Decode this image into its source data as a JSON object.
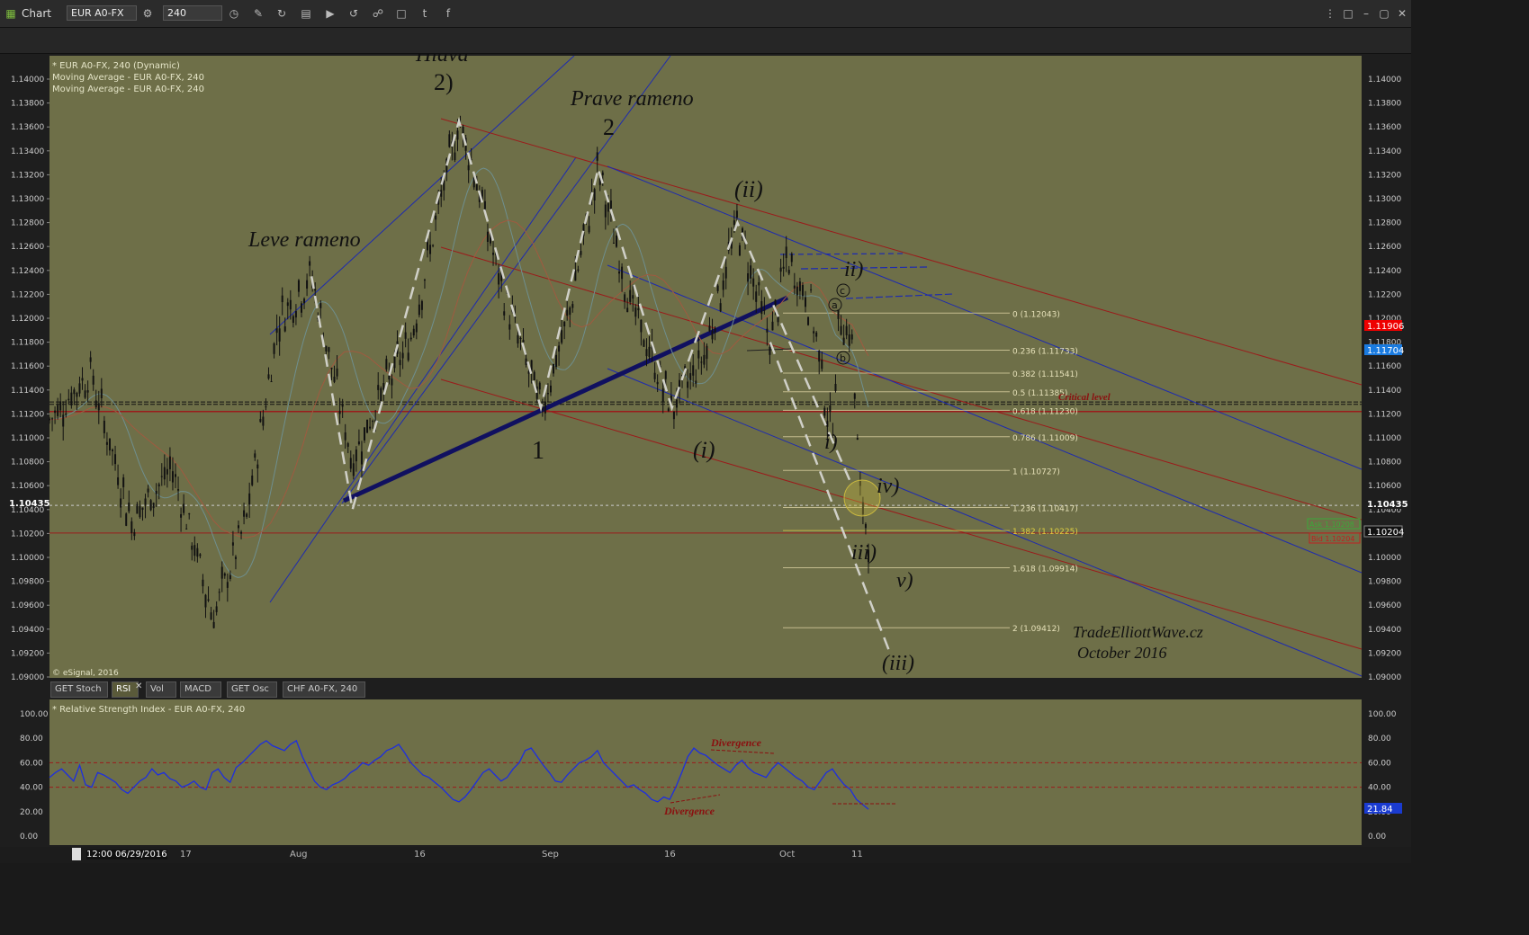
{
  "window": {
    "title": "Chart",
    "symbol": "EUR A0-FX",
    "interval": "240"
  },
  "legend": [
    "* EUR A0-FX, 240 (Dynamic)",
    "Moving Average - EUR A0-FX, 240",
    "Moving Average - EUR A0-FX, 240"
  ],
  "copyright": "© eSignal, 2016",
  "watermark": {
    "line1": "TradeElliottWave.cz",
    "line2": "October  2016"
  },
  "price_badges": {
    "red": "1.11906",
    "blue": "1.11704",
    "current": "1.10435",
    "bid_box": "1.10204",
    "ask_label": "Ask 1.10208",
    "bid_label": "Bid 1.10204"
  },
  "current_left": "1.10435",
  "indicator_tabs": [
    "GET Stoch",
    "RSI",
    "Vol",
    "MACD",
    "GET Osc",
    "CHF A0-FX, 240"
  ],
  "rsi": {
    "title": "* Relative Strength Index - EUR A0-FX, 240",
    "value_badge": "21.84",
    "divergence_top": "Divergence",
    "divergence_bottom": "Divergence"
  },
  "x_axis": {
    "cursor": "12:00 06/29/2016",
    "labels": [
      "17",
      "Aug",
      "16",
      "Sep",
      "16",
      "Oct",
      "11"
    ]
  },
  "annotations": {
    "hlava": "Hlava",
    "hlava_num": "2)",
    "leve": "Leve rameno",
    "prave": "Prave rameno",
    "prave_num": "2",
    "one": "1",
    "ii_paren": "(ii)",
    "i_paren": "(i)",
    "ii_small": "ii)",
    "i_small": "i)",
    "iv": "iv)",
    "iii_small": "iii)",
    "v": "v)",
    "iii_paren": "(iii)",
    "a": "a",
    "b": "b",
    "c": "c",
    "critical": "Critical level"
  },
  "fib_labels": [
    "0 (1.12043)",
    "0.236 (1.11733)",
    "0.382 (1.11541)",
    "0.5 (1.11385)",
    "0.618 (1.11230)",
    "0.786 (1.11009)",
    "1 (1.10727)",
    "1.236 (1.10417)",
    "1.382 (1.10225)",
    "1.618 (1.09914)",
    "2 (1.09412)"
  ],
  "chart_data": [
    {
      "type": "candlestick",
      "title": "* EUR A0-FX, 240 (Dynamic)",
      "xlabel": "",
      "ylabel": "",
      "x_ticks": [
        "17",
        "Aug",
        "16",
        "Sep",
        "16",
        "Oct",
        "11"
      ],
      "y_ticks": [
        "1.14000",
        "1.13800",
        "1.13600",
        "1.13400",
        "1.13200",
        "1.13000",
        "1.12800",
        "1.12600",
        "1.12400",
        "1.12200",
        "1.12000",
        "1.11800",
        "1.11600",
        "1.11400",
        "1.11200",
        "1.11000",
        "1.10800",
        "1.10600",
        "1.10400",
        "1.10200",
        "1.10000",
        "1.09800",
        "1.09600",
        "1.09400",
        "1.09200",
        "1.09000"
      ],
      "ylim": [
        1.09,
        1.1415
      ],
      "swing_path": [
        {
          "t": 0.0,
          "price": 1.1115
        },
        {
          "t": 0.05,
          "price": 1.1155
        },
        {
          "t": 0.1,
          "price": 1.103
        },
        {
          "t": 0.15,
          "price": 1.1075
        },
        {
          "t": 0.2,
          "price": 1.095
        },
        {
          "t": 0.24,
          "price": 1.103
        },
        {
          "t": 0.28,
          "price": 1.12
        },
        {
          "t": 0.32,
          "price": 1.1235
        },
        {
          "t": 0.37,
          "price": 1.108
        },
        {
          "t": 0.4,
          "price": 1.113
        },
        {
          "t": 0.44,
          "price": 1.118
        },
        {
          "t": 0.48,
          "price": 1.1305
        },
        {
          "t": 0.5,
          "price": 1.1365
        },
        {
          "t": 0.52,
          "price": 1.132
        },
        {
          "t": 0.55,
          "price": 1.123
        },
        {
          "t": 0.6,
          "price": 1.1125
        },
        {
          "t": 0.63,
          "price": 1.119
        },
        {
          "t": 0.67,
          "price": 1.1325
        },
        {
          "t": 0.71,
          "price": 1.121
        },
        {
          "t": 0.76,
          "price": 1.1125
        },
        {
          "t": 0.8,
          "price": 1.117
        },
        {
          "t": 0.84,
          "price": 1.128
        },
        {
          "t": 0.88,
          "price": 1.118
        },
        {
          "t": 0.9,
          "price": 1.125
        },
        {
          "t": 0.93,
          "price": 1.121
        },
        {
          "t": 0.955,
          "price": 1.11
        },
        {
          "t": 0.965,
          "price": 1.1205
        },
        {
          "t": 0.98,
          "price": 1.118
        },
        {
          "t": 0.99,
          "price": 1.105
        },
        {
          "t": 1.0,
          "price": 1.102
        }
      ],
      "horizontal_levels": [
        1.113,
        1.1128,
        1.1122,
        1.10204
      ],
      "fibonacci": [
        {
          "ratio": 0,
          "price": 1.12043
        },
        {
          "ratio": 0.236,
          "price": 1.11733
        },
        {
          "ratio": 0.382,
          "price": 1.11541
        },
        {
          "ratio": 0.5,
          "price": 1.11385
        },
        {
          "ratio": 0.618,
          "price": 1.1123
        },
        {
          "ratio": 0.786,
          "price": 1.11009
        },
        {
          "ratio": 1,
          "price": 1.10727
        },
        {
          "ratio": 1.236,
          "price": 1.10417
        },
        {
          "ratio": 1.382,
          "price": 1.10225
        },
        {
          "ratio": 1.618,
          "price": 1.09914
        },
        {
          "ratio": 2,
          "price": 1.09412
        }
      ],
      "current_price": 1.10435
    },
    {
      "type": "line",
      "title": "* Relative Strength Index - EUR A0-FX, 240",
      "xlabel": "",
      "ylabel": "",
      "y_ticks": [
        "100.00",
        "80.00",
        "60.00",
        "40.00",
        "20.00",
        "0.00"
      ],
      "ylim": [
        0,
        100
      ],
      "reference_levels": [
        60,
        40
      ],
      "rsi_points": [
        48,
        52,
        55,
        50,
        45,
        58,
        42,
        40,
        52,
        50,
        47,
        44,
        38,
        35,
        40,
        45,
        48,
        55,
        50,
        52,
        47,
        45,
        40,
        42,
        45,
        40,
        38,
        52,
        55,
        48,
        44,
        56,
        60,
        65,
        70,
        75,
        78,
        74,
        72,
        70,
        75,
        78,
        65,
        55,
        45,
        40,
        38,
        42,
        44,
        47,
        52,
        55,
        60,
        58,
        62,
        65,
        70,
        72,
        75,
        68,
        60,
        55,
        50,
        48,
        44,
        40,
        35,
        30,
        28,
        32,
        38,
        45,
        52,
        55,
        50,
        45,
        48,
        55,
        60,
        70,
        72,
        65,
        58,
        52,
        45,
        44,
        50,
        55,
        60,
        62,
        65,
        70,
        60,
        55,
        50,
        45,
        40,
        42,
        38,
        35,
        30,
        28,
        32,
        30,
        40,
        52,
        65,
        72,
        68,
        66,
        62,
        58,
        55,
        52,
        58,
        62,
        56,
        52,
        50,
        48,
        55,
        60,
        56,
        52,
        48,
        45,
        40,
        38,
        45,
        52,
        55,
        48,
        42,
        38,
        30,
        26,
        22
      ],
      "value": 21.84
    }
  ]
}
